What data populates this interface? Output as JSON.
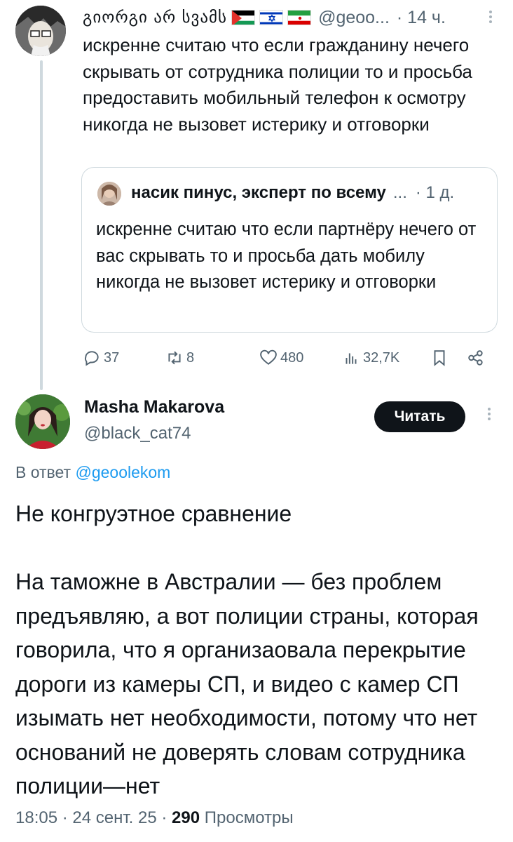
{
  "parent_tweet": {
    "author_name": "გიორგი არ სვამს",
    "flags": [
      "palestine-flag",
      "israel-flag",
      "iran-flag"
    ],
    "handle": "@geoo...",
    "time": "· 14 ч.",
    "text": "искренне считаю что если гражданину нечего скрывать от сотрудника полиции то и просьба предоставить мобильный телефон к осмотру никогда не вызовет истерику и отговорки",
    "quote": {
      "author_name": "насик пинус, эксперт по всему",
      "ellipsis": "...",
      "time": "· 1 д.",
      "text": "искренне считаю что если партнёру нечего от вас скрывать то и просьба дать мобилу никогда не вызовет истерику и отговорки"
    },
    "actions": {
      "replies": "37",
      "reposts": "8",
      "likes": "480",
      "views": "32,7K"
    }
  },
  "reply_tweet": {
    "author_name": "Masha Makarova",
    "handle": "@black_cat74",
    "follow_label": "Читать",
    "reply_prefix": "В ответ",
    "reply_mention": "@geoolekom",
    "text": "Не конгруэтное сравнение\n\nНа таможне в Австралии — без проблем предъявляю, а вот полиции страны, которая говорила, что я организаовала перекрытие дороги из камеры СП, и видео с камер СП изымать нет необходимости, потому что нет оснований не доверять словам сотрудника полиции—нет",
    "time": "18:05 · 24 сент. 25 ·",
    "views_count": "290",
    "views_label": "Просмотры"
  },
  "colors": {
    "text": "#0f1419",
    "secondary": "#536471",
    "link": "#1d9bf0",
    "border": "#cfd9de",
    "button_bg": "#0f1419"
  }
}
